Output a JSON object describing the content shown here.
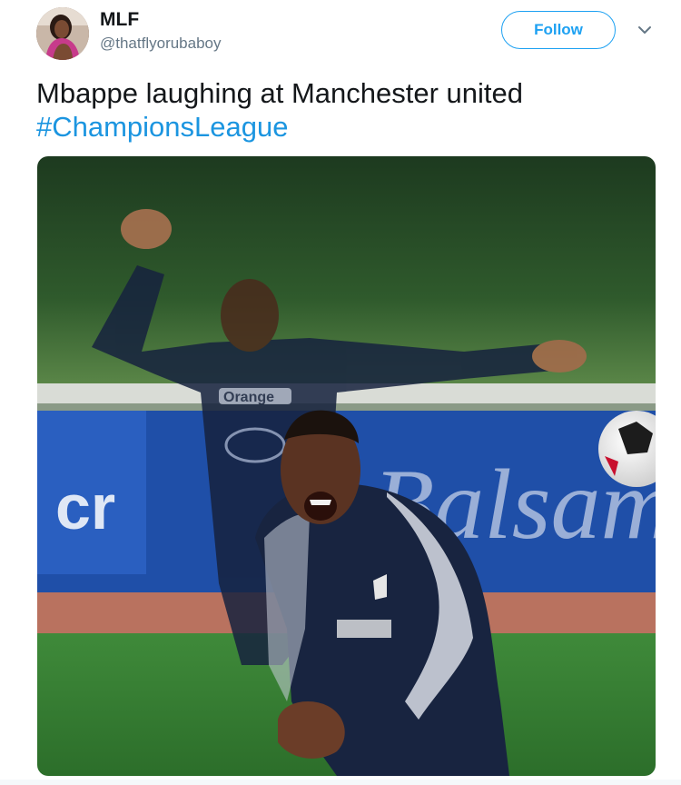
{
  "user": {
    "name": "MLF",
    "handle": "@thatflyorubaboy",
    "avatar_icon": "user-avatar-photo"
  },
  "follow": {
    "label": "Follow"
  },
  "menu": {
    "icon": "chevron-down-icon"
  },
  "tweet": {
    "text": "Mbappe laughing at Manchester united",
    "hashtag": "#ChampionsLeague"
  },
  "media": {
    "shirt_sponsor": "Orange",
    "banner_text": "Balsam",
    "alt_icon": "football-photo"
  },
  "colors": {
    "accent": "#1da1f2",
    "hashtag": "#1b95e0",
    "handle": "#657786",
    "text": "#14171a"
  }
}
